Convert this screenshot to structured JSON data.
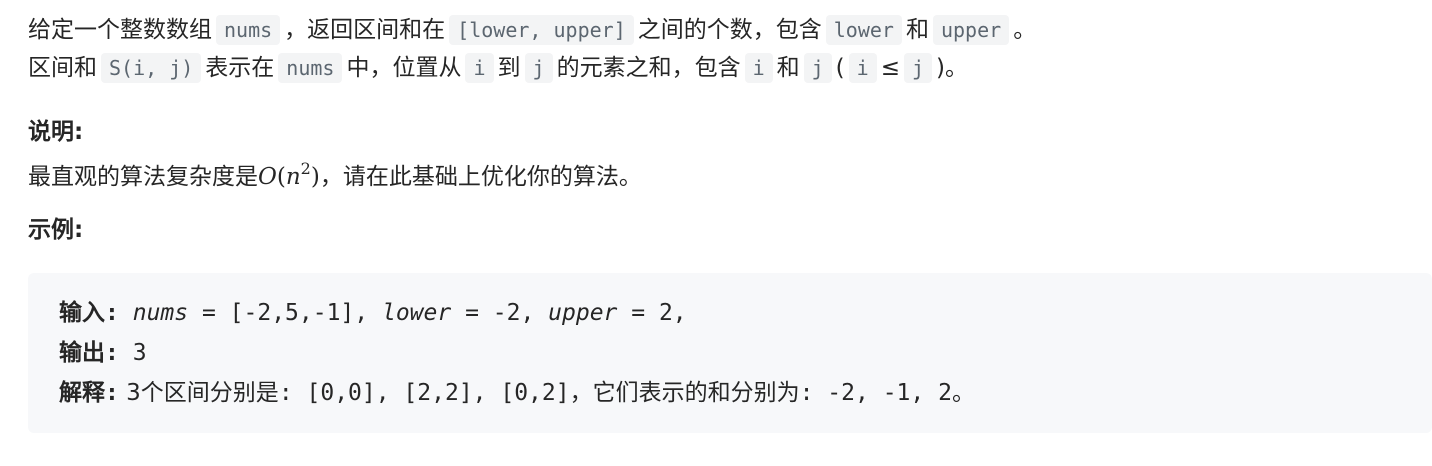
{
  "description": {
    "line1": {
      "t1": "给定一个整数数组",
      "c1": "nums",
      "t2": "，返回区间和在",
      "c2": "[lower, upper]",
      "t3": "之间的个数，包含",
      "c3": "lower",
      "t4": "和",
      "c4": "upper",
      "t5": "。"
    },
    "line2": {
      "t1": "区间和",
      "c1": "S(i, j)",
      "t2": "表示在",
      "c2": "nums",
      "t3": "中，位置从",
      "c3": "i",
      "t4": "到",
      "c4": "j",
      "t5": "的元素之和，包含",
      "c5": "i",
      "t6": "和",
      "c6": "j",
      "t7": "(",
      "c7": "i",
      "t8": "≤",
      "c8": "j",
      "t9": ")。"
    }
  },
  "note": {
    "heading": "说明:",
    "text_before": "最直观的算法复杂度是",
    "math_O": "O",
    "math_open": "(",
    "math_n": "n",
    "math_exp": "2",
    "math_close": ")",
    "text_after": "，请在此基础上优化你的算法。"
  },
  "example": {
    "heading": "示例:",
    "input_label": "输入",
    "input_colon": ":",
    "input_nums_name": "nums",
    "input_nums_value": " = [-2,5,-1], ",
    "input_lower_name": "lower",
    "input_lower_value": " = -2, ",
    "input_upper_name": "upper",
    "input_upper_value": " = 2,",
    "output_label": "输出",
    "output_colon": ":",
    "output_value": " 3",
    "explain_label": "解释",
    "explain_colon": ":",
    "explain_t1": " 3个区间分别是",
    "explain_t2": ": [0,0], [2,2], [0,2]",
    "explain_t3": "，它们表示的和分别为",
    "explain_t4": ": -2, -1, 2",
    "explain_t5": "。"
  }
}
